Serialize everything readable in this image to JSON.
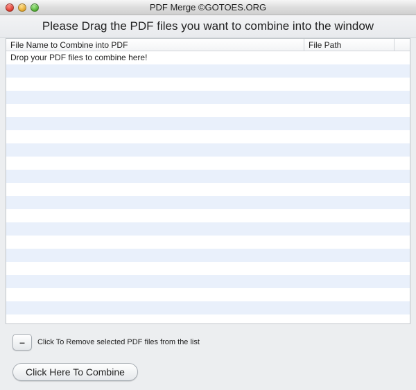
{
  "window": {
    "title": "PDF Merge ©GOTOES.ORG"
  },
  "instruction": "Please Drag the PDF files you want to combine into the window",
  "table": {
    "headers": {
      "name": "File Name to Combine into PDF",
      "path": "File Path"
    },
    "placeholder_row": "Drop your PDF files to combine here!"
  },
  "controls": {
    "remove_glyph": "–",
    "remove_label": "Click To Remove selected PDF files from the list",
    "combine_label": "Click Here To Combine"
  }
}
